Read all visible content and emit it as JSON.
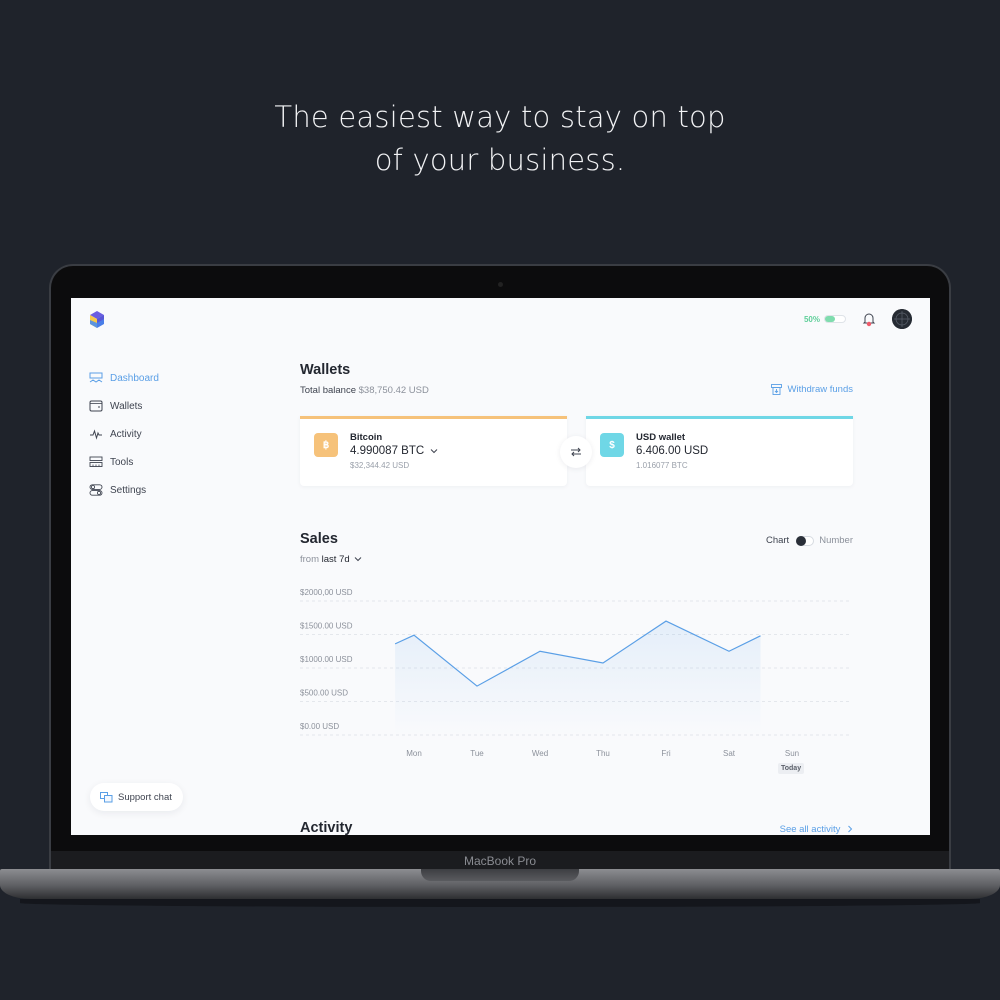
{
  "headline": {
    "line1": "The easiest way to stay on top",
    "line2": "of your business."
  },
  "device": {
    "label": "MacBook Pro"
  },
  "app": {
    "logo": "cube-logo-icon",
    "topbar": {
      "battery_percent_label": "50%",
      "battery_fraction": 0.5,
      "bell_icon": "bell-icon",
      "has_notification": true,
      "avatar_icon": "globe-avatar"
    },
    "sidebar": {
      "items": [
        {
          "label": "Dashboard",
          "icon": "dashboard-icon",
          "active": true
        },
        {
          "label": "Wallets",
          "icon": "wallet-icon",
          "active": false
        },
        {
          "label": "Activity",
          "icon": "activity-icon",
          "active": false
        },
        {
          "label": "Tools",
          "icon": "tools-icon",
          "active": false
        },
        {
          "label": "Settings",
          "icon": "settings-icon",
          "active": false
        }
      ],
      "support_chat": "Support chat"
    },
    "wallets": {
      "title": "Wallets",
      "total_label": "Total balance",
      "total_value": "$38,750.42 USD",
      "withdraw_label": "Withdraw funds",
      "cards": [
        {
          "name": "Bitcoin",
          "symbol": "฿",
          "amount": "4.990087 BTC",
          "secondary": "$32,344.42 USD",
          "color": "#f6c27a",
          "bar_color": "#f6c27a",
          "has_dropdown": true
        },
        {
          "name": "USD wallet",
          "symbol": "$",
          "amount": "6.406.00 USD",
          "secondary": "1.016077 BTC",
          "color": "#6fd7e6",
          "bar_color": "#6fd7e6",
          "has_dropdown": false
        }
      ],
      "swap_icon": "swap-arrows-icon"
    },
    "sales": {
      "title": "Sales",
      "range_prefix": "from",
      "range_value": "last 7d",
      "toggle_left": "Chart",
      "toggle_right": "Number",
      "today_badge": "Today"
    },
    "activity": {
      "title": "Activity",
      "see_all": "See all activity"
    },
    "accent": "#5a9fe6"
  },
  "chart_data": {
    "type": "area",
    "title": "Sales",
    "categories": [
      "Mon",
      "Tue",
      "Wed",
      "Thu",
      "Fri",
      "Sat",
      "Sun"
    ],
    "series": [
      {
        "name": "Sales (USD)",
        "x": [
          -0.3,
          0,
          1,
          2,
          3,
          4,
          5,
          5.5
        ],
        "values": [
          1360,
          1490,
          730,
          1250,
          1075,
          1700,
          1250,
          1480
        ]
      }
    ],
    "yticks": [
      0,
      500,
      1000,
      1500,
      2000
    ],
    "ytick_labels": [
      "$0.00 USD",
      "$500.00 USD",
      "$1000.00 USD",
      "$1500.00 USD",
      "$2000,00 USD"
    ],
    "ylim": [
      0,
      2000
    ],
    "xlabel": "",
    "ylabel": "",
    "grid": true,
    "line_color": "#5a9fe6",
    "highlight_category": "Sun"
  }
}
